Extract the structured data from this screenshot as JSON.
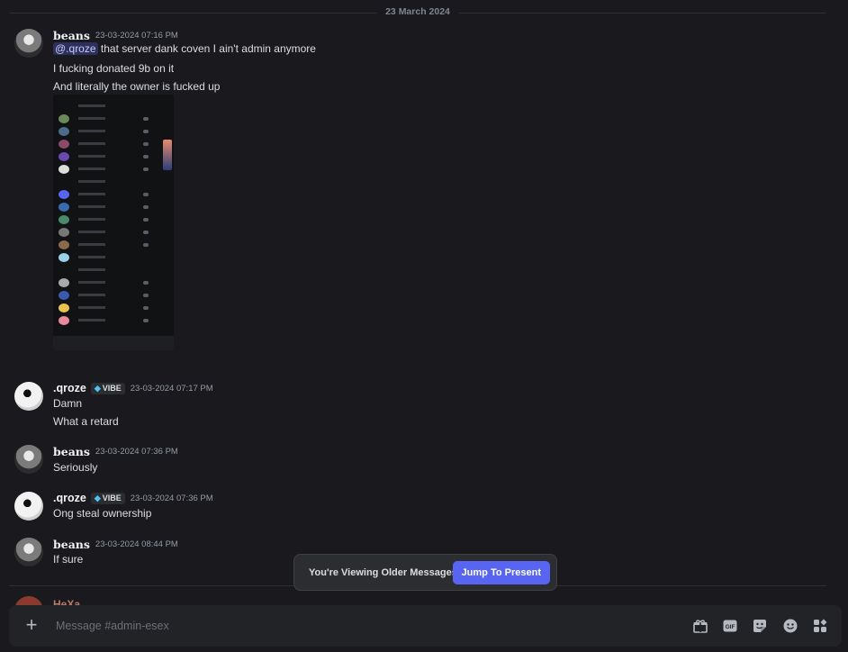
{
  "chat": {
    "date_divider": "23 March 2024",
    "messages": [
      {
        "author": "beans",
        "timestamp": "23-03-2024 07:16 PM",
        "mention": "@.qroze",
        "lines": [
          "that server dank coven I ain't admin anymore",
          "I fucking donated 9b on it",
          "And literally the owner is fucked up"
        ]
      },
      {
        "author": ".qroze",
        "tag": "VIBE",
        "timestamp": "23-03-2024 07:17 PM",
        "lines": [
          "Damn",
          "What a retard"
        ]
      },
      {
        "author": "beans",
        "timestamp": "23-03-2024 07:36 PM",
        "lines": [
          "Seriously"
        ]
      },
      {
        "author": ".qroze",
        "tag": "VIBE",
        "timestamp": "23-03-2024 07:36 PM",
        "lines": [
          "Ong steal ownership"
        ]
      },
      {
        "author": "beans",
        "timestamp": "23-03-2024 08:44 PM",
        "lines": [
          "If sure"
        ]
      }
    ],
    "partial_author": "HeXa"
  },
  "jump_bar": {
    "notice": "You're Viewing Older Messages",
    "button_label": "Jump To Present"
  },
  "composer": {
    "placeholder": "Message #admin-esex",
    "tools": [
      "gift-icon",
      "gif-icon",
      "sticker-icon",
      "emoji-icon",
      "apps-icon"
    ]
  },
  "colors": {
    "background": "#1a1a1e",
    "accent": "#5865f2",
    "mention_bg": "#3b3f7a"
  }
}
